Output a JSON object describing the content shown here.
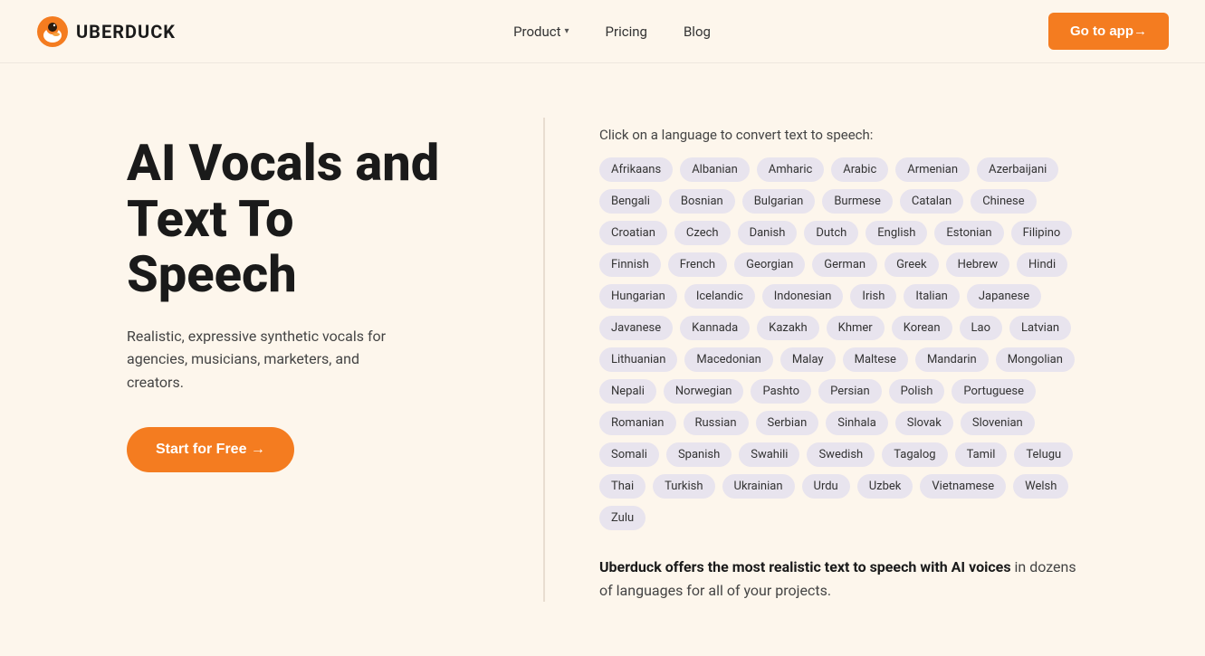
{
  "nav": {
    "logo_text": "UBERDUCK",
    "links": [
      {
        "label": "Product",
        "has_chevron": true
      },
      {
        "label": "Pricing",
        "has_chevron": false
      },
      {
        "label": "Blog",
        "has_chevron": false
      }
    ],
    "cta_label": "Go to app→"
  },
  "hero": {
    "title": "AI Vocals and Text To Speech",
    "subtitle": "Realistic, expressive synthetic vocals for agencies, musicians, marketers, and creators.",
    "cta_label": "Start for Free →",
    "lang_prompt": "Click on a language to convert text to speech:",
    "languages": [
      "Afrikaans",
      "Albanian",
      "Amharic",
      "Arabic",
      "Armenian",
      "Azerbaijani",
      "Bengali",
      "Bosnian",
      "Bulgarian",
      "Burmese",
      "Catalan",
      "Chinese",
      "Croatian",
      "Czech",
      "Danish",
      "Dutch",
      "English",
      "Estonian",
      "Filipino",
      "Finnish",
      "French",
      "Georgian",
      "German",
      "Greek",
      "Hebrew",
      "Hindi",
      "Hungarian",
      "Icelandic",
      "Indonesian",
      "Irish",
      "Italian",
      "Japanese",
      "Javanese",
      "Kannada",
      "Kazakh",
      "Khmer",
      "Korean",
      "Lao",
      "Latvian",
      "Lithuanian",
      "Macedonian",
      "Malay",
      "Maltese",
      "Mandarin",
      "Mongolian",
      "Nepali",
      "Norwegian",
      "Pashto",
      "Persian",
      "Polish",
      "Portuguese",
      "Romanian",
      "Russian",
      "Serbian",
      "Sinhala",
      "Slovak",
      "Slovenian",
      "Somali",
      "Spanish",
      "Swahili",
      "Swedish",
      "Tagalog",
      "Tamil",
      "Telugu",
      "Thai",
      "Turkish",
      "Ukrainian",
      "Urdu",
      "Uzbek",
      "Vietnamese",
      "Welsh",
      "Zulu"
    ],
    "description": "Uberduck offers the most realistic text to speech with AI voices in dozens of languages for all of your projects."
  }
}
